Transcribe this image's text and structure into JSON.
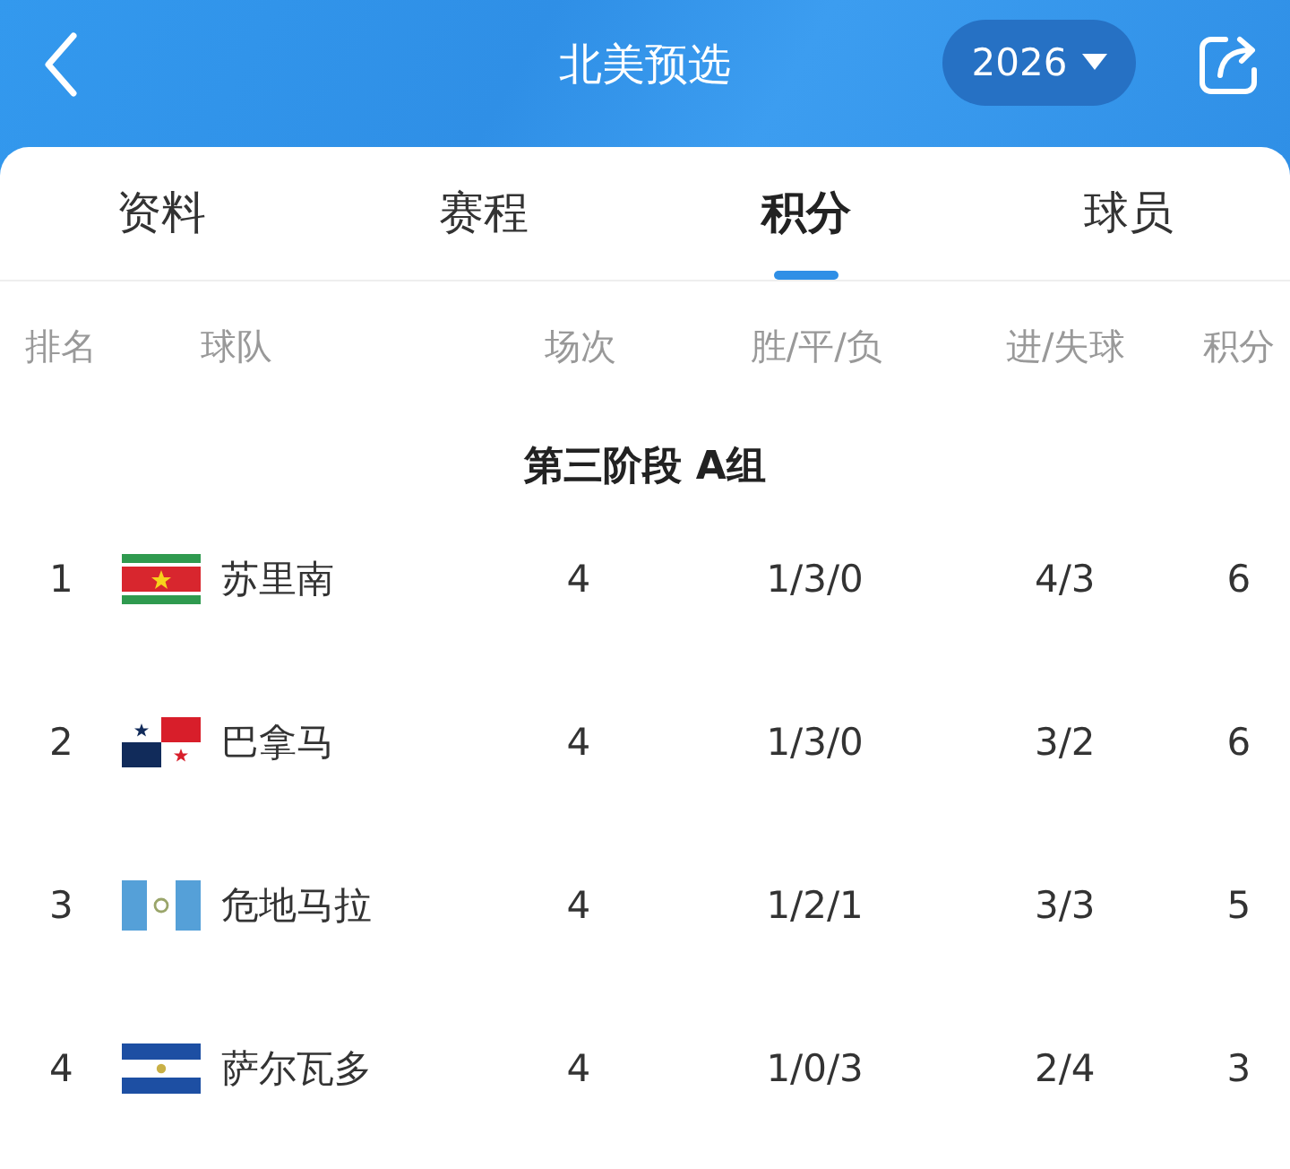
{
  "header": {
    "title": "北美预选",
    "season": "2026"
  },
  "tabs": [
    {
      "label": "资料",
      "selected": false
    },
    {
      "label": "赛程",
      "selected": false
    },
    {
      "label": "积分",
      "selected": true
    },
    {
      "label": "球员",
      "selected": false
    }
  ],
  "table": {
    "columns": [
      "排名",
      "球队",
      "场次",
      "胜/平/负",
      "进/失球",
      "积分"
    ],
    "group": "第三阶段 A组",
    "rows": [
      {
        "rank": "1",
        "kind": "suriname",
        "team": "苏里南",
        "played": "4",
        "wdl": "1/3/0",
        "goals": "4/3",
        "points": "6"
      },
      {
        "rank": "2",
        "kind": "panama",
        "team": "巴拿马",
        "played": "4",
        "wdl": "1/3/0",
        "goals": "3/2",
        "points": "6"
      },
      {
        "rank": "3",
        "kind": "guatemala",
        "team": "危地马拉",
        "played": "4",
        "wdl": "1/2/1",
        "goals": "3/3",
        "points": "5"
      },
      {
        "rank": "4",
        "kind": "elsalvador",
        "team": "萨尔瓦多",
        "played": "4",
        "wdl": "1/0/3",
        "goals": "2/4",
        "points": "3"
      }
    ]
  }
}
